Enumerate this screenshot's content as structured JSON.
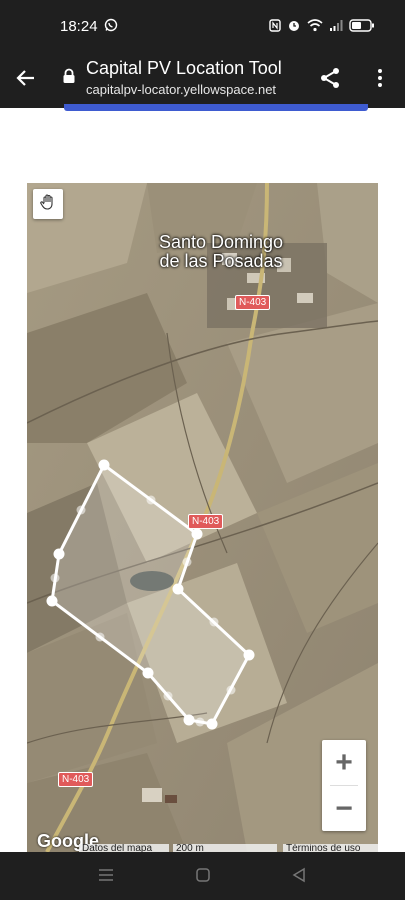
{
  "status": {
    "time": "18:24",
    "battery_icon": "battery-icon"
  },
  "app_bar": {
    "title": "Capital PV Location Tool",
    "url": "capitalpv-locator.yellowspace.net"
  },
  "map": {
    "town_label": "Santo Domingo de las Posadas",
    "road_labels": [
      "N-403",
      "N-403",
      "N-403"
    ],
    "zoom_in": "+",
    "zoom_out": "−",
    "google_logo": "Google",
    "attribution": {
      "data": "Datos del mapa",
      "scale": "200 m",
      "terms": "Términos de uso"
    }
  }
}
